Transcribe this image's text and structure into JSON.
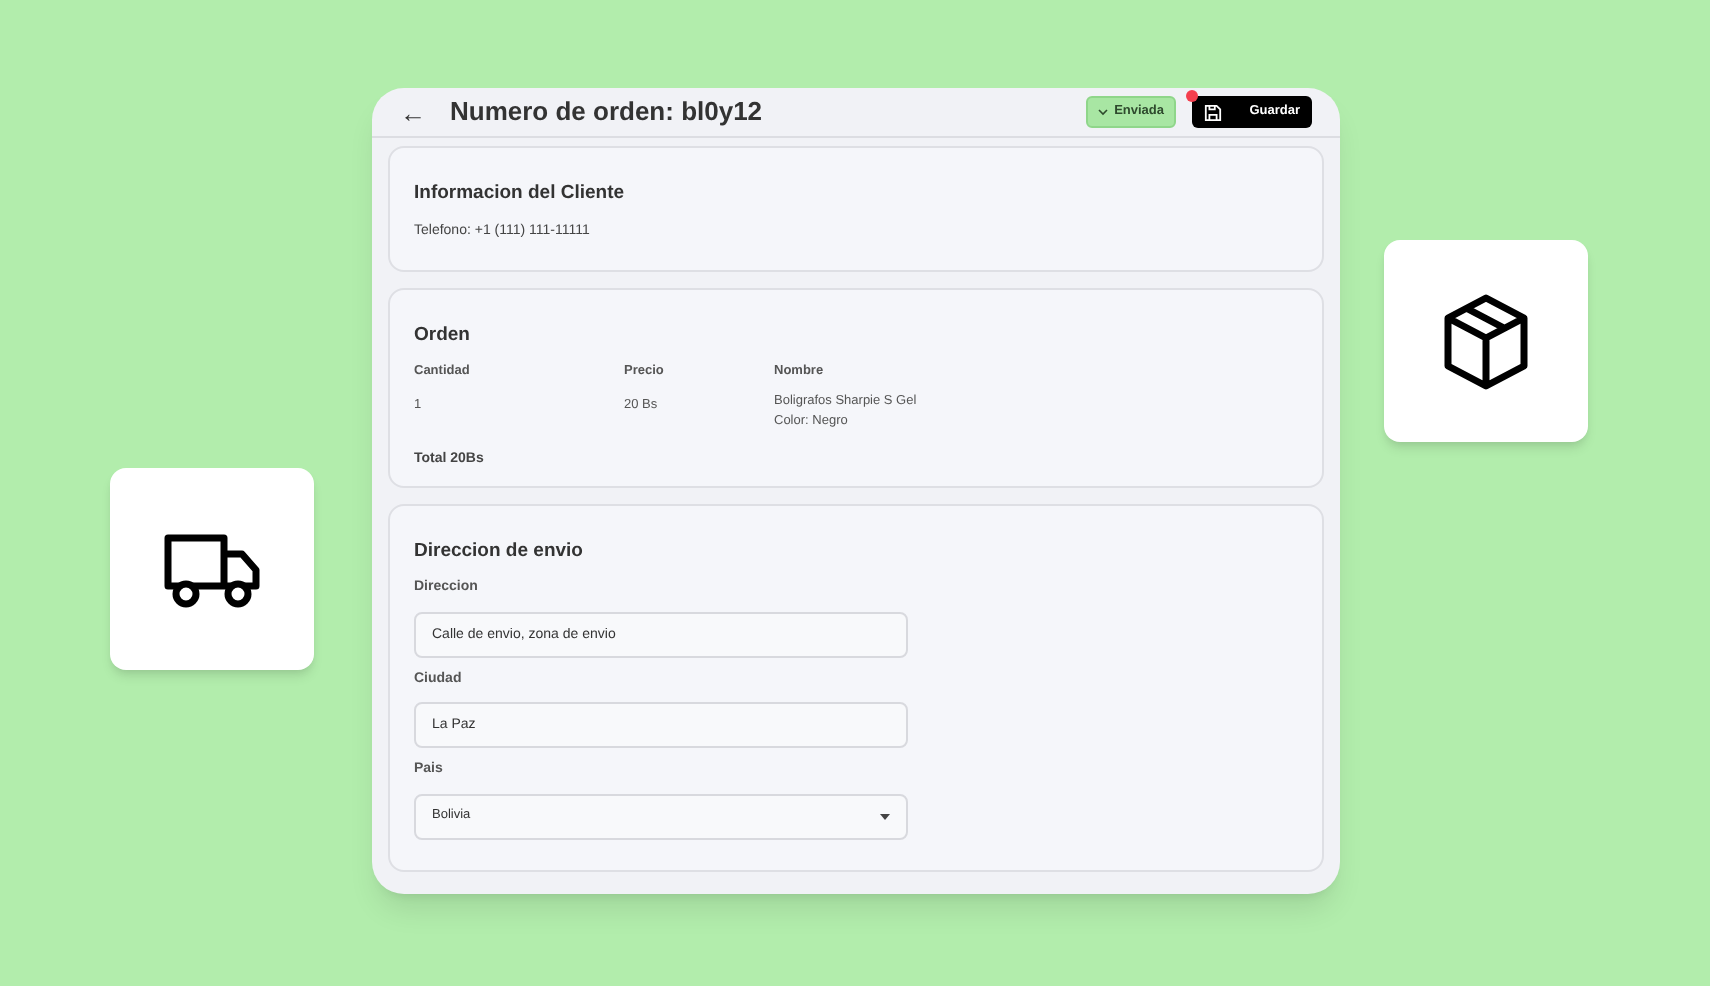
{
  "header": {
    "back": "←",
    "title": "Numero de orden: bl0y12",
    "status": {
      "label": "Enviada"
    },
    "save": {
      "label": "Guardar",
      "dot": true
    }
  },
  "customer": {
    "title": "Informacion del Cliente",
    "phone": "Telefono: +1 (111) 111-11111"
  },
  "order": {
    "title": "Orden",
    "columns": [
      "Cantidad",
      "Precio",
      "Nombre"
    ],
    "rows": [
      {
        "cells": [
          "1",
          "20 Bs",
          "Boligrafos Sharpie S Gel"
        ],
        "detail": "Color: Negro"
      }
    ],
    "total": "Total 20Bs"
  },
  "shipping": {
    "title": "Direccion de envio",
    "fields": [
      {
        "kind": "text",
        "label": "Direccion",
        "value": "Calle de envio, zona de envio"
      },
      {
        "kind": "text",
        "label": "Ciudad",
        "value": "La Paz"
      },
      {
        "kind": "select",
        "label": "Pais",
        "value": "Bolivia"
      }
    ]
  }
}
